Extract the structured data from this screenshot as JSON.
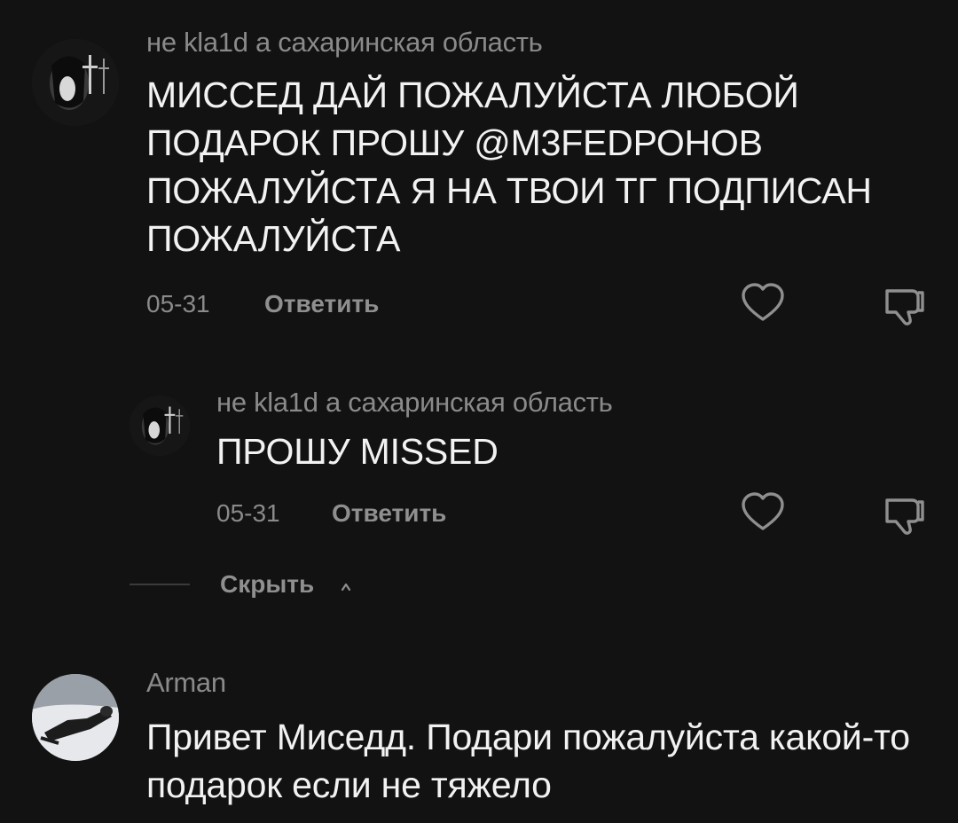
{
  "comments": [
    {
      "username": "не kla1d а сахаринская область",
      "text": "МИССЕД ДАЙ ПОЖАЛУЙСТА ЛЮБОЙ ПОДАРОК ПРОШУ @M3FEDРОНОВ ПОЖАЛУЙСТА Я НА ТВОИ ТГ ПОДПИСАН ПОЖАЛУЙСТА",
      "date": "05-31",
      "reply_label": "Ответить",
      "replies": [
        {
          "username": "не kla1d а сахаринская область",
          "text": "ПРОШУ MISSED",
          "date": "05-31",
          "reply_label": "Ответить"
        }
      ],
      "hide_replies_label": "Скрыть"
    },
    {
      "username": "Arman",
      "text": "Привет Миседд. Подари пожалуйста какой-то подарок если не тяжело"
    }
  ],
  "icons": {
    "like": "heart-outline-icon",
    "dislike": "thumbs-down-outline-icon",
    "collapse": "chevron-up-icon"
  },
  "colors": {
    "background": "#121212",
    "username": "#8a8a8a",
    "text": "#f2f2f2",
    "secondary": "#8f8f8f"
  }
}
